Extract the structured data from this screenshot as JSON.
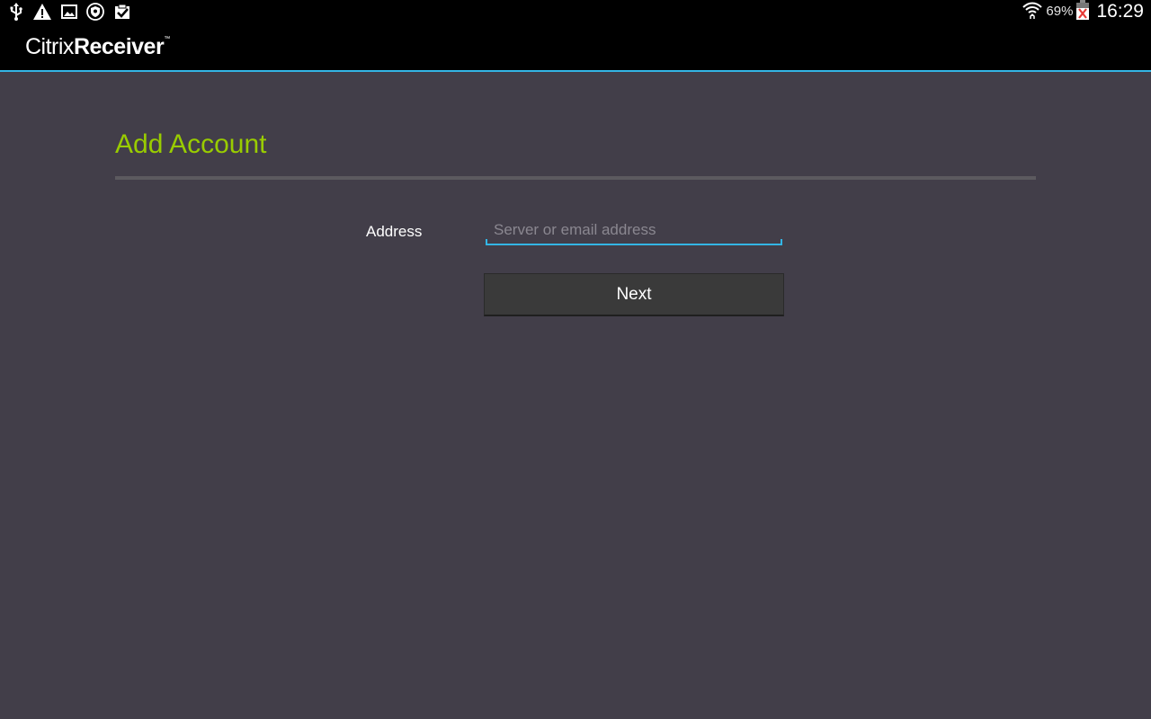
{
  "status_bar": {
    "left_icons": [
      "usb-icon",
      "warning-icon",
      "image-icon",
      "shield-icon",
      "clipboard-check-icon"
    ],
    "wifi_icon": "wifi-icon",
    "battery_percent": "69%",
    "battery_icon": "battery-icon",
    "time": "16:29"
  },
  "app": {
    "brand_light": "Citrix",
    "brand_bold": "Receiver",
    "trademark": "™",
    "accent_color": "#33b5e5"
  },
  "page": {
    "title": "Add Account",
    "title_color": "#99cc00"
  },
  "form": {
    "address_label": "Address",
    "address_value": "",
    "address_placeholder": "Server or email address",
    "next_label": "Next"
  }
}
